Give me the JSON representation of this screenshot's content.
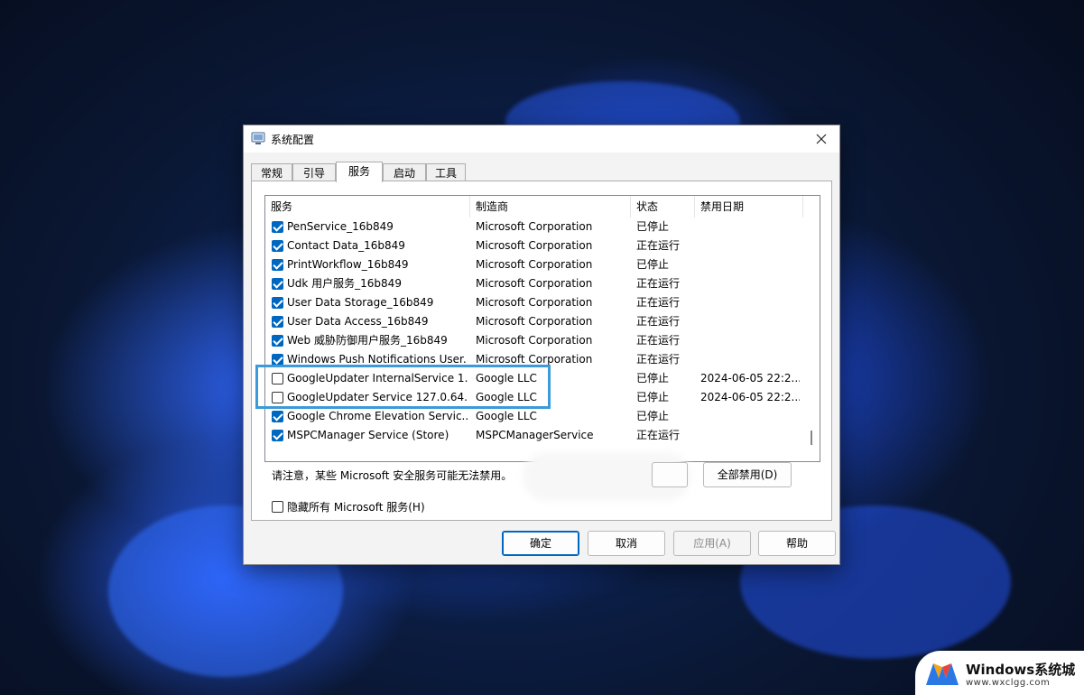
{
  "window": {
    "title": "系统配置"
  },
  "tabs": [
    {
      "label": "常规"
    },
    {
      "label": "引导"
    },
    {
      "label": "服务"
    },
    {
      "label": "启动"
    },
    {
      "label": "工具"
    }
  ],
  "columns": {
    "service": "服务",
    "vendor": "制造商",
    "status": "状态",
    "disabled_date": "禁用日期"
  },
  "rows": [
    {
      "checked": true,
      "name": "PenService_16b849",
      "vendor": "Microsoft Corporation",
      "status": "已停止",
      "date": ""
    },
    {
      "checked": true,
      "name": "Contact Data_16b849",
      "vendor": "Microsoft Corporation",
      "status": "正在运行",
      "date": ""
    },
    {
      "checked": true,
      "name": "PrintWorkflow_16b849",
      "vendor": "Microsoft Corporation",
      "status": "已停止",
      "date": ""
    },
    {
      "checked": true,
      "name": "Udk 用户服务_16b849",
      "vendor": "Microsoft Corporation",
      "status": "正在运行",
      "date": ""
    },
    {
      "checked": true,
      "name": "User Data Storage_16b849",
      "vendor": "Microsoft Corporation",
      "status": "正在运行",
      "date": ""
    },
    {
      "checked": true,
      "name": "User Data Access_16b849",
      "vendor": "Microsoft Corporation",
      "status": "正在运行",
      "date": ""
    },
    {
      "checked": true,
      "name": "Web 威胁防御用户服务_16b849",
      "vendor": "Microsoft Corporation",
      "status": "正在运行",
      "date": ""
    },
    {
      "checked": true,
      "name": "Windows Push Notifications User...",
      "vendor": "Microsoft Corporation",
      "status": "正在运行",
      "date": ""
    },
    {
      "checked": false,
      "name": "GoogleUpdater InternalService 1...",
      "vendor": "Google LLC",
      "status": "已停止",
      "date": "2024-06-05 22:2..."
    },
    {
      "checked": false,
      "name": "GoogleUpdater Service 127.0.64...",
      "vendor": "Google LLC",
      "status": "已停止",
      "date": "2024-06-05 22:2..."
    },
    {
      "checked": true,
      "name": "Google Chrome Elevation Servic...",
      "vendor": "Google LLC",
      "status": "已停止",
      "date": ""
    },
    {
      "checked": true,
      "name": "MSPCManager Service (Store)",
      "vendor": "MSPCManagerService",
      "status": "正在运行",
      "date": ""
    }
  ],
  "notice": "请注意，某些 Microsoft 安全服务可能无法禁用。",
  "disable_all_label": "全部禁用(D)",
  "hide_ms_label": "隐藏所有 Microsoft 服务(H)",
  "buttons": {
    "ok": "确定",
    "cancel": "取消",
    "apply": "应用(A)",
    "help": "帮助"
  },
  "watermark": {
    "title": "Windows系统城",
    "url": "www.wxclgg.com"
  },
  "colors": {
    "accent": "#0067c0",
    "highlight": "#3d9ad8"
  }
}
